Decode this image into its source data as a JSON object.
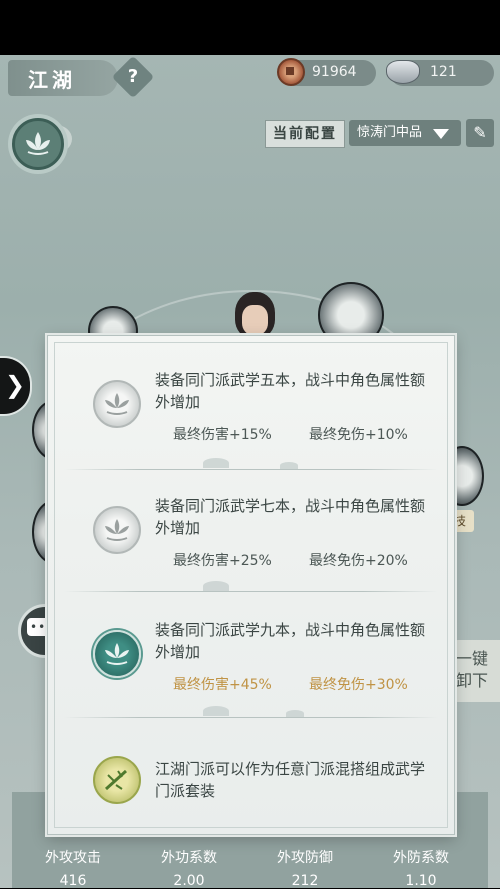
{
  "header": {
    "title": "江湖",
    "help": "?",
    "copper_amount": "91964",
    "silver_amount": "121"
  },
  "preset": {
    "label": "当前配置",
    "selected": "惊涛门中品"
  },
  "side": {
    "arrow": "❯",
    "right_tag": "技",
    "one_click": "一键卸下"
  },
  "stats": [
    {
      "label": "外攻攻击",
      "value": "416"
    },
    {
      "label": "外功系数",
      "value": "2.00"
    },
    {
      "label": "外攻防御",
      "value": "212"
    },
    {
      "label": "外防系数",
      "value": "1.10"
    }
  ],
  "modal": {
    "tiers": [
      {
        "desc": "装备同门派武学五本，战斗中角色属性额外增加",
        "bonus1": "最终伤害+15%",
        "bonus2": "最终免伤+10%",
        "icon": "lotus-gray-icon"
      },
      {
        "desc": "装备同门派武学七本，战斗中角色属性额外增加",
        "bonus1": "最终伤害+25%",
        "bonus2": "最终免伤+20%",
        "icon": "lotus-gray-icon"
      },
      {
        "desc": "装备同门派武学九本，战斗中角色属性额外增加",
        "bonus1": "最终伤害+45%",
        "bonus2": "最终免伤+30%",
        "icon": "lotus-green-icon"
      }
    ],
    "note": "江湖门派可以作为任意门派混搭组成武学门派套装"
  },
  "colors": {
    "active_bonus": "#c09345",
    "inactive_bonus": "#4c5755",
    "accent_green": "#3f8e84"
  }
}
